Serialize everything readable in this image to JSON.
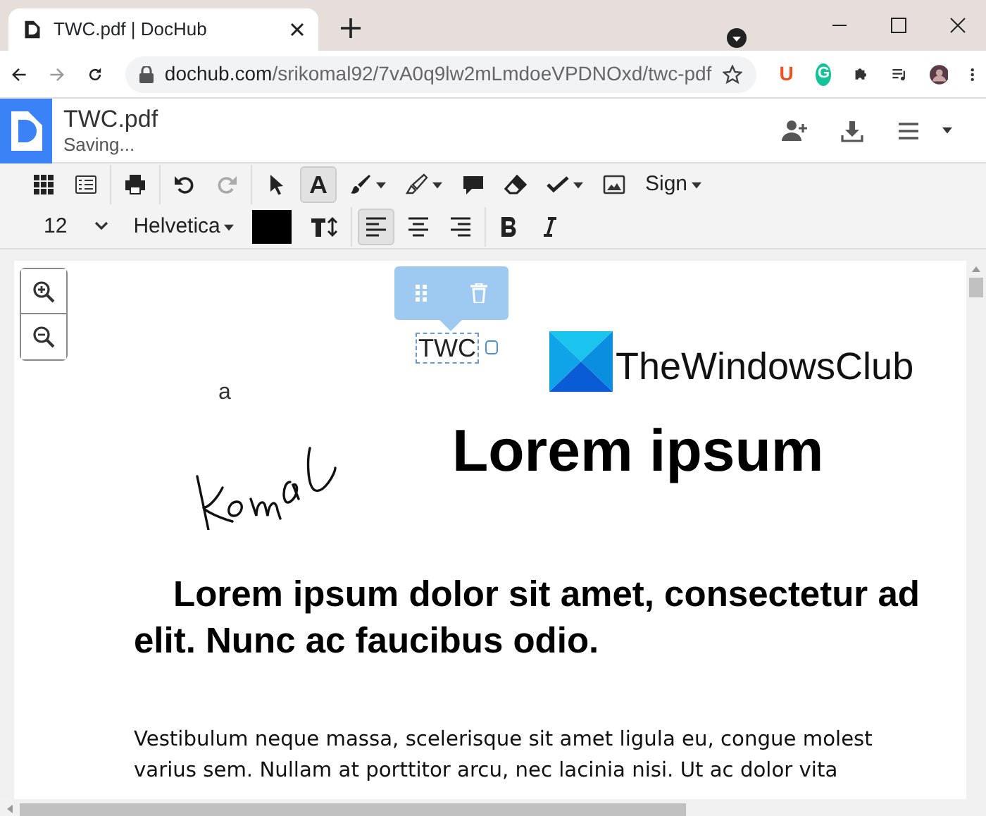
{
  "browser": {
    "tab": {
      "title": "TWC.pdf | DocHub"
    },
    "address": {
      "host": "dochub.com",
      "path": "/srikomal92/7vA0q9lw2mLmdoeVPDNOxd/twc-pdf"
    },
    "extensions": [
      {
        "kind": "u",
        "label": "U"
      },
      {
        "kind": "grammar",
        "label": "G"
      },
      {
        "kind": "puzzle"
      },
      {
        "kind": "playlist"
      },
      {
        "kind": "avatar"
      }
    ]
  },
  "app": {
    "title": "TWC.pdf",
    "status": "Saving..."
  },
  "toolbar": {
    "groups": [
      [
        {
          "kind": "grid",
          "selected": false
        },
        {
          "kind": "list",
          "selected": false
        }
      ],
      [
        {
          "kind": "print",
          "selected": false
        }
      ],
      [
        {
          "kind": "undo",
          "selected": false,
          "disabled": false
        },
        {
          "kind": "redo",
          "selected": false,
          "disabled": true
        }
      ],
      [
        {
          "kind": "pointer",
          "selected": false
        },
        {
          "kind": "text",
          "selected": true
        },
        {
          "kind": "pen",
          "selected": false,
          "menu": true
        },
        {
          "kind": "highlighter",
          "selected": false,
          "menu": true
        },
        {
          "kind": "comment",
          "selected": false
        },
        {
          "kind": "eraser",
          "selected": false
        },
        {
          "kind": "check",
          "selected": false,
          "menu": true
        },
        {
          "kind": "image",
          "selected": false
        },
        {
          "kind": "sign",
          "label": "Sign",
          "selected": false,
          "menu": true
        }
      ]
    ]
  },
  "format_bar": {
    "font_size": "12",
    "font": "Helvetica",
    "color": "#000000",
    "align": [
      {
        "kind": "left",
        "selected": true
      },
      {
        "kind": "center",
        "selected": false
      },
      {
        "kind": "right",
        "selected": false
      }
    ],
    "bold": false,
    "italic": false
  },
  "document": {
    "text_box": {
      "text": "TWC"
    },
    "letter": "a",
    "logo_text": "TheWindowsClub",
    "heading": "Lorem ipsum",
    "subheading": [
      "Lorem ipsum dolor sit amet, consectetur ad",
      "elit. Nunc ac faucibus odio."
    ],
    "paragraph": [
      "Vestibulum neque massa, scelerisque sit amet ligula eu, congue molest",
      "varius sem. Nullam at porttitor arcu, nec lacinia nisi. Ut ac dolor vita"
    ]
  }
}
